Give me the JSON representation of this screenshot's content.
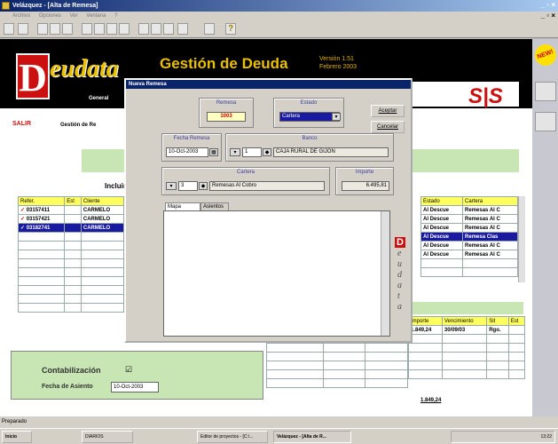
{
  "window": {
    "title": "Velázquez - [Alta de Remesa]",
    "controls_top": "_ ▫ ×",
    "controls_sub": "_ ▫ ×"
  },
  "menu": [
    "Archivo",
    "Opciones",
    "Ver",
    "Ventana",
    "?"
  ],
  "banner": {
    "logo_letter": "D",
    "logo_text": "eudata",
    "logo_sub": "General",
    "title": "Gestión de Deuda",
    "version": "Versión 1.51",
    "date": "Febrero 2003",
    "brand": "S|S"
  },
  "nav": {
    "exit": "SALIR",
    "section": "Gestión de Re"
  },
  "new_badge": "NEW!",
  "left_grid": {
    "heading": "Incluir",
    "headers": [
      "Refer.",
      "Est",
      "Cliente"
    ],
    "rows": [
      {
        "check": "✓",
        "ref": "03157411",
        "client": "CARMELO"
      },
      {
        "check": "✓",
        "ref": "03157421",
        "client": "CARMELO"
      },
      {
        "check": "✓",
        "ref": "03182741",
        "client": "CARMELO"
      }
    ]
  },
  "right_grid": {
    "headers": [
      "Estado",
      "Cartera"
    ],
    "rows": [
      [
        "Al Descue",
        "Remesas Al C"
      ],
      [
        "Al Descue",
        "Remesas Al C"
      ],
      [
        "Al Descue",
        "Remesas Al C"
      ],
      [
        "Al Descue",
        "Remesa Clas"
      ],
      [
        "Al Descue",
        "Remesas Al C"
      ],
      [
        "Al Descue",
        "Remesas Al C"
      ]
    ],
    "selected_index": 3
  },
  "lower_grid": {
    "headers": [
      "Importe",
      "Vencimiento",
      "Sit",
      "Est"
    ],
    "rows": [
      [
        "1.849,24",
        "30/09/03",
        "Rgo.",
        ""
      ]
    ],
    "total": "1.849,24"
  },
  "accounting": {
    "label": "Contabilización",
    "checked": "☑",
    "date_label": "Fecha de Asiento",
    "date_value": "10-Oct-2003"
  },
  "dialog": {
    "title": "Nueva Remesa",
    "remesa_label": "Remesa",
    "remesa_value": "1003",
    "estado_label": "Estado",
    "estado_value": "Cartera",
    "accept": "Aceptar",
    "cancel": "Cancelar",
    "fecha_label": "Fecha Remesa",
    "fecha_value": "10-Oct-2003",
    "banco_label": "Banco",
    "banco_num": "1",
    "banco_value": "CAJA RURAL DE GIJON",
    "cartera_label": "Cartera",
    "cartera_num": "3",
    "cartera_value": "Remesas Al Cobro",
    "importe_label": "Importe",
    "importe_value": "6.495,81",
    "tabs": [
      "Mapa fichero",
      "Asientos"
    ],
    "side_logo": "D",
    "side_letters": [
      "e",
      "u",
      "d",
      "a",
      "t",
      "a"
    ]
  },
  "status": "Preparado",
  "taskbar": {
    "start": "Inicio",
    "items": [
      "DIARIOS",
      "Editor de proyectos - [C:\\...",
      "Velázquez - [Alta de R..."
    ],
    "clock": "13:22"
  },
  "colors": {
    "title_bar": "#0a246a",
    "banner": "#000000",
    "accent_red": "#cc1010",
    "gold": "#e8c000",
    "green_band": "#c8e6b4",
    "grid_header": "#ffff60",
    "selection": "#1a1aa0"
  }
}
